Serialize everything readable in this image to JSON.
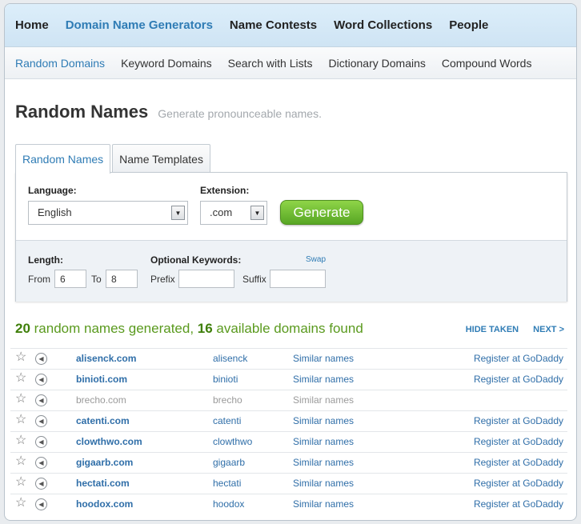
{
  "nav": {
    "main": [
      "Home",
      "Domain Name Generators",
      "Name Contests",
      "Word Collections",
      "People"
    ],
    "active": 1,
    "sub": [
      "Random Domains",
      "Keyword Domains",
      "Search with Lists",
      "Dictionary Domains",
      "Compound Words"
    ],
    "sub_active": 0
  },
  "page": {
    "title": "Random Names",
    "subtitle": "Generate pronounceable names."
  },
  "tabs": [
    "Random Names",
    "Name Templates"
  ],
  "form": {
    "language_label": "Language:",
    "language_value": "English",
    "extension_label": "Extension:",
    "extension_value": ".com",
    "generate_label": "Generate",
    "length_label": "Length:",
    "from_label": "From",
    "from_value": "6",
    "to_label": "To",
    "to_value": "8",
    "keywords_label": "Optional Keywords:",
    "swap_label": "Swap",
    "prefix_label": "Prefix",
    "prefix_value": "",
    "suffix_label": "Suffix",
    "suffix_value": ""
  },
  "summary": {
    "generated_count": "20",
    "generated_text": " random names generated, ",
    "available_count": "16",
    "available_text": " available domains found",
    "hide_taken": "HIDE TAKEN",
    "next": "NEXT >"
  },
  "results": [
    {
      "domain": "alisenck.com",
      "word": "alisenck",
      "similar": "Similar names",
      "register": "Register at GoDaddy",
      "taken": false
    },
    {
      "domain": "binioti.com",
      "word": "binioti",
      "similar": "Similar names",
      "register": "Register at GoDaddy",
      "taken": false
    },
    {
      "domain": "brecho.com",
      "word": "brecho",
      "similar": "Similar names",
      "register": "",
      "taken": true
    },
    {
      "domain": "catenti.com",
      "word": "catenti",
      "similar": "Similar names",
      "register": "Register at GoDaddy",
      "taken": false
    },
    {
      "domain": "clowthwo.com",
      "word": "clowthwo",
      "similar": "Similar names",
      "register": "Register at GoDaddy",
      "taken": false
    },
    {
      "domain": "gigaarb.com",
      "word": "gigaarb",
      "similar": "Similar names",
      "register": "Register at GoDaddy",
      "taken": false
    },
    {
      "domain": "hectati.com",
      "word": "hectati",
      "similar": "Similar names",
      "register": "Register at GoDaddy",
      "taken": false
    },
    {
      "domain": "hoodox.com",
      "word": "hoodox",
      "similar": "Similar names",
      "register": "Register at GoDaddy",
      "taken": false
    }
  ],
  "colors": {
    "accent": "#2f7cb5",
    "success": "#5a9a1e",
    "button": "#6ab830"
  },
  "icons": {
    "favorite": "star-icon",
    "pronounce": "speaker-icon",
    "dropdown": "dropdown-arrow-icon"
  }
}
